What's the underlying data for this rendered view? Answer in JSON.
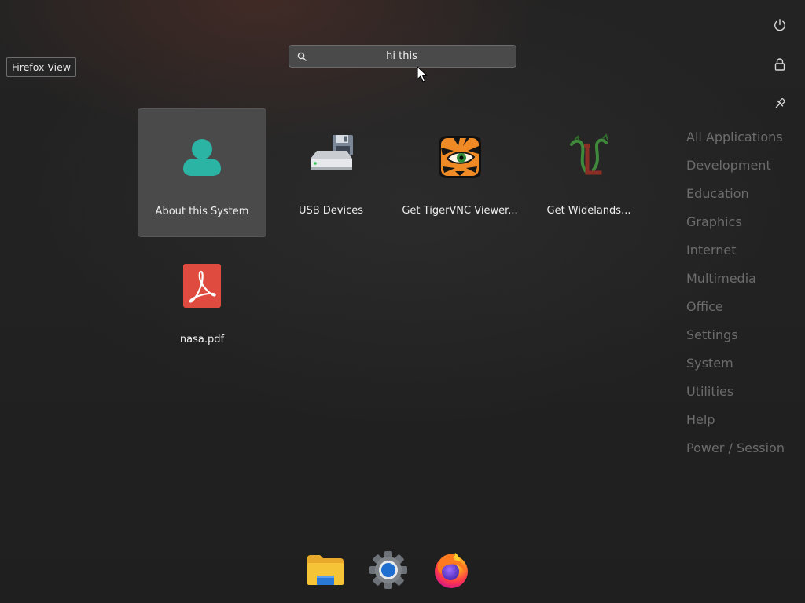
{
  "tooltip": {
    "text": "Firefox View"
  },
  "search": {
    "value": "hi this",
    "icon": "search-icon"
  },
  "top_buttons": [
    {
      "name": "power-icon"
    },
    {
      "name": "lock-icon"
    },
    {
      "name": "pin-icon"
    }
  ],
  "results": [
    {
      "label": "About this System",
      "icon": "user-icon",
      "selected": true
    },
    {
      "label": "USB Devices",
      "icon": "usb-drive-icon"
    },
    {
      "label": "Get TigerVNC Viewer...",
      "icon": "tigervnc-icon"
    },
    {
      "label": "Get Widelands...",
      "icon": "widelands-icon"
    },
    {
      "label": "nasa.pdf",
      "icon": "pdf-icon"
    }
  ],
  "categories": [
    "All Applications",
    "Development",
    "Education",
    "Graphics",
    "Internet",
    "Multimedia",
    "Office",
    "Settings",
    "System",
    "Utilities",
    "Help",
    "Power / Session"
  ],
  "dock": [
    {
      "name": "file-manager-icon"
    },
    {
      "name": "settings-icon"
    },
    {
      "name": "firefox-icon"
    }
  ],
  "colors": {
    "accent_teal": "#2bb3a3",
    "pdf_red": "#e04b3f",
    "folder_yellow": "#f6c437",
    "category_text": "#6c6c6c"
  }
}
